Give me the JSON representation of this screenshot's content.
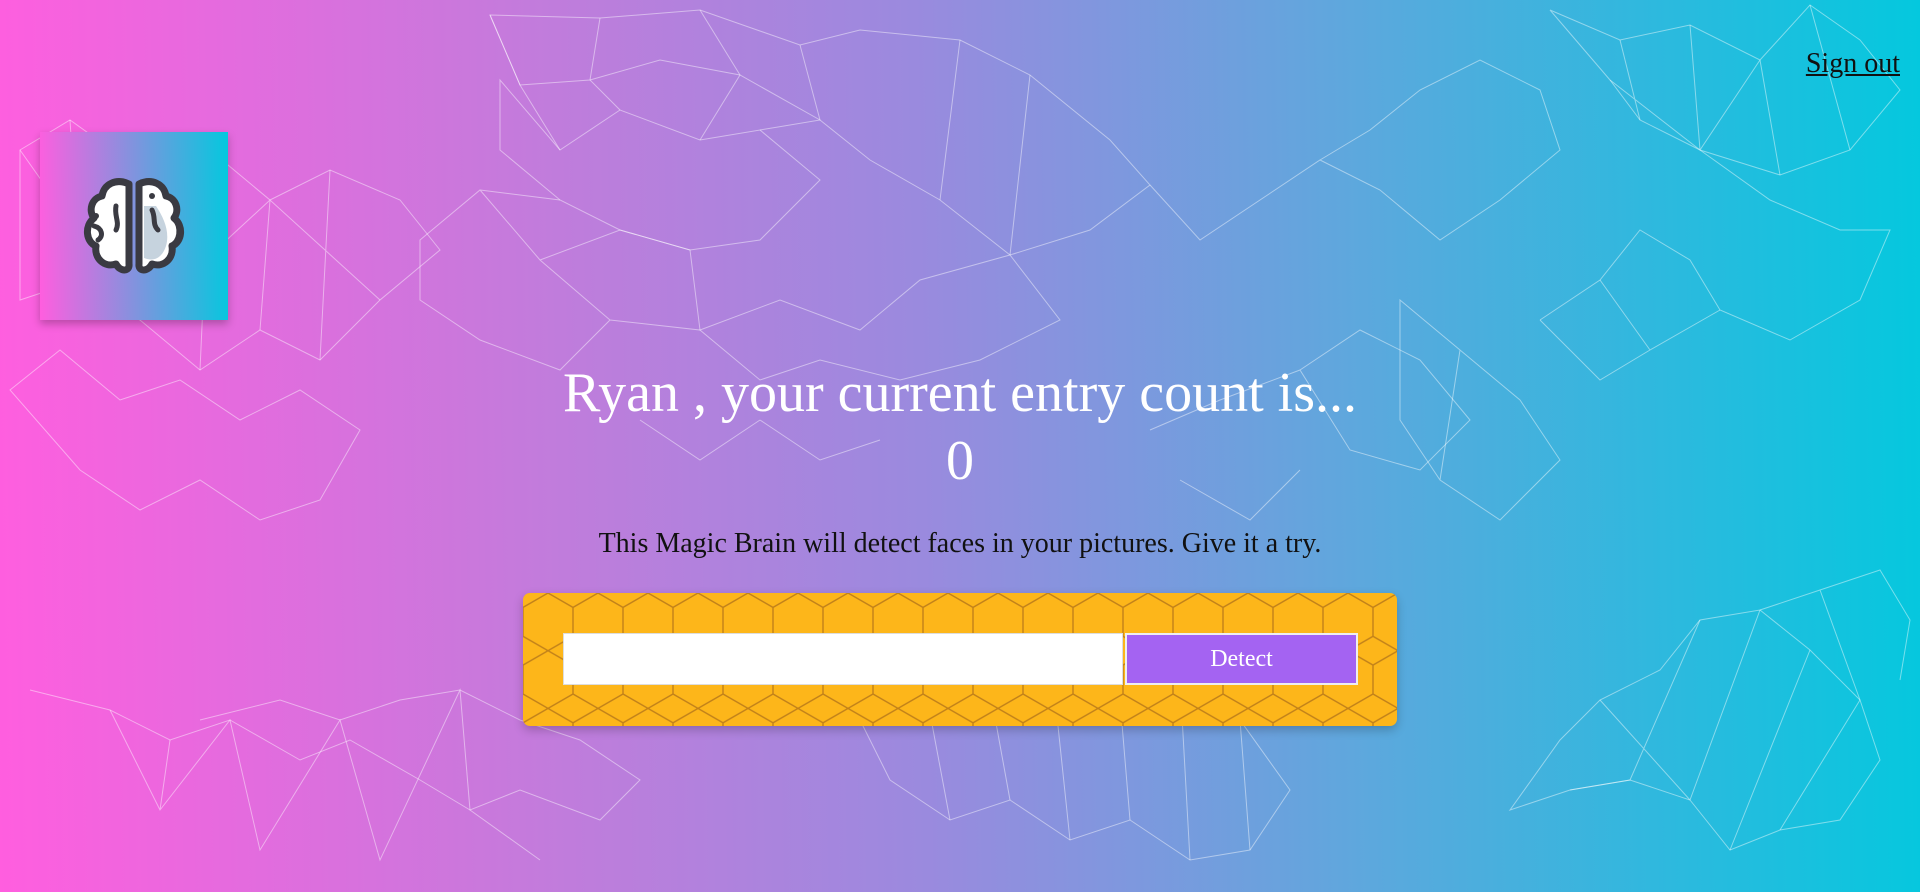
{
  "nav": {
    "signout_label": "Sign out"
  },
  "logo": {
    "icon": "brain-icon"
  },
  "rank": {
    "message": "Ryan , your current entry count is...",
    "entries": "0"
  },
  "intro": {
    "text": "This Magic Brain will detect faces in your pictures. Give it a try."
  },
  "form": {
    "input_value": "",
    "input_placeholder": "",
    "detect_label": "Detect"
  },
  "colors": {
    "gradient_start": "#ff5edf",
    "gradient_end": "#04c8de",
    "panel": "#fdb61a",
    "button": "#a463f2"
  }
}
